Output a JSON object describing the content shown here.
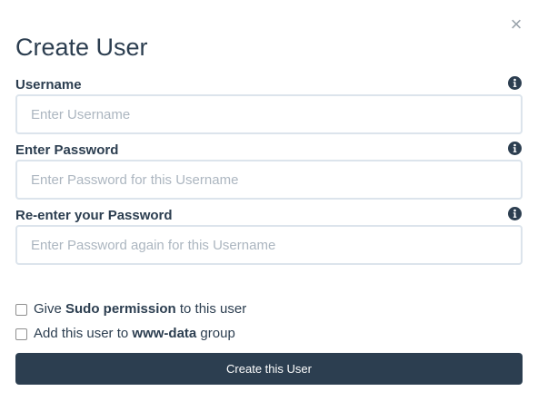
{
  "modal": {
    "title": "Create User",
    "close_glyph": "×",
    "close_icon": "close-icon"
  },
  "fields": [
    {
      "label": "Username",
      "placeholder": "Enter Username",
      "value": "",
      "help_icon": "info-circle-icon"
    },
    {
      "label": "Enter Password",
      "placeholder": "Enter Password for this Username",
      "value": "",
      "help_icon": "info-circle-icon"
    },
    {
      "label": "Re-enter your Password",
      "placeholder": "Enter Password again for this Username",
      "value": "",
      "help_icon": "info-circle-icon"
    }
  ],
  "options": [
    {
      "checked": false,
      "text_before": "Give ",
      "text_bold": "Sudo permission",
      "text_after": " to this user"
    },
    {
      "checked": false,
      "text_before": "Add this user to ",
      "text_bold": "www-data",
      "text_after": " group"
    }
  ],
  "submit_label": "Create this User",
  "colors": {
    "primary": "#2c3e50",
    "input_border": "#dce4ec",
    "placeholder": "#acb6c0",
    "close": "#9aa3ab"
  }
}
